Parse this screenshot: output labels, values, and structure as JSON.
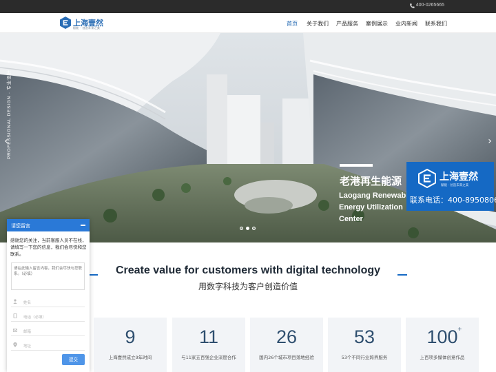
{
  "topbar": {
    "phone": "400-0265665",
    "phone_icon": "phone-icon"
  },
  "brand": {
    "name": "上海壹然",
    "tagline": "赋能 · 创造未来之美",
    "logo_icon": "e-logo-icon"
  },
  "nav": {
    "items": [
      "首页",
      "关于我们",
      "产品服务",
      "案例展示",
      "业内新闻",
      "联系我们"
    ],
    "active_index": 0
  },
  "hero": {
    "side_label": "PROFESSIONAL DESIGN · 专业设计",
    "caption_cn": "老港再生能源",
    "caption_en": "Laogang Renewable Energy Utilization Center",
    "prev_icon": "chevron-left-icon",
    "next_icon": "chevron-right-icon",
    "slides_count": 3,
    "active_slide": 1
  },
  "contact_card": {
    "brand": "上海壹然",
    "tagline": "赋能 · 创造未来之美",
    "phone": "联系电话：400-8950806"
  },
  "section": {
    "title_en": "Create value for customers with digital technology",
    "title_cn": "用数字科技为客户创造价值"
  },
  "stats": [
    {
      "value": "9",
      "label": "上海壹然成立9年时间"
    },
    {
      "value": "11",
      "label": "与11家五百强企业深度合作"
    },
    {
      "value": "26",
      "label": "国内26个城市项目落地经验"
    },
    {
      "value": "53",
      "label": "53个不同行业跨界服务"
    },
    {
      "value": "100",
      "label": "上百项多媒体创意作品",
      "suffix": "+"
    }
  ],
  "chat": {
    "title": "请您留言",
    "message": "感谢您的关注，当前客服人员不在线，请填写一下您的信息，我们会尽快和您联系。",
    "textarea_placeholder": "请在此输入留言内容，我们会尽快与您联系。（必填）",
    "fields": [
      {
        "placeholder": "姓名",
        "icon": "user-icon"
      },
      {
        "placeholder": "电话（必填）",
        "icon": "phone-icon"
      },
      {
        "placeholder": "邮箱",
        "icon": "mail-icon"
      },
      {
        "placeholder": "地址",
        "icon": "location-icon"
      }
    ],
    "submit": "提交"
  },
  "colors": {
    "brand_blue": "#1569c4",
    "topbar": "#2b2b2b",
    "nav_active": "#2a6db5"
  }
}
